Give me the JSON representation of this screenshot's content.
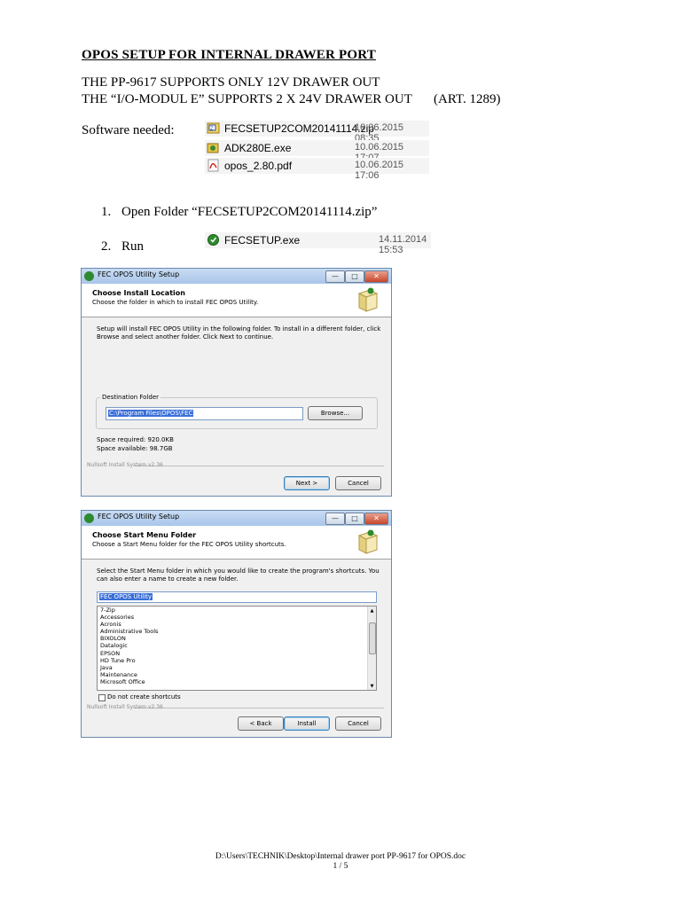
{
  "doc": {
    "title": "OPOS SETUP FOR INTERNAL DRAWER PORT",
    "line1": "THE PP-9617 SUPPORTS ONLY 12V DRAWER OUT",
    "line2": "THE “I/O-MODUL E” SUPPORTS 2 X 24V DRAWER OUT",
    "line2_art": "(ART. 1289)",
    "software_label": "Software needed:",
    "files": [
      {
        "name": "FECSETUP2COM20141114.zip",
        "date": "10.06.2015 08:35",
        "icon": "zip-icon"
      },
      {
        "name": "ADK280E.exe",
        "date": "10.06.2015 17:07",
        "icon": "exe-icon"
      },
      {
        "name": "opos_2.80.pdf",
        "date": "10.06.2015 17:06",
        "icon": "pdf-icon"
      }
    ],
    "step1_num": "1.",
    "step1_text": "Open Folder “FECSETUP2COM20141114.zip”",
    "step2_num": "2.",
    "step2_text": "Run",
    "run_file": {
      "name": "FECSETUP.exe",
      "date": "14.11.2014 15:53",
      "icon": "setup-icon"
    }
  },
  "dialog1": {
    "title": "FEC OPOS Utility Setup",
    "heading": "Choose Install Location",
    "subheading": "Choose the folder in which to install FEC OPOS Utility.",
    "body1": "Setup will install FEC OPOS Utility in the following folder. To install in a different folder, click",
    "body2": "Browse and select another folder. Click Next to continue.",
    "dest_label": "Destination Folder",
    "dest_value": "C:\\Program Files\\OPOS\\FEC",
    "browse": "Browse...",
    "space_required": "Space required: 920.0KB",
    "space_available": "Space available: 98.7GB",
    "nsis": "Nullsoft Install System v2.36",
    "next": "Next >",
    "cancel": "Cancel"
  },
  "dialog2": {
    "title": "FEC OPOS Utility Setup",
    "heading": "Choose Start Menu Folder",
    "subheading": "Choose a Start Menu folder for the FEC OPOS Utility shortcuts.",
    "body1": "Select the Start Menu folder in which you would like to create the program's shortcuts. You",
    "body2": "can also enter a name to create a new folder.",
    "folder_value": "FEC OPOS Utility",
    "list_items": [
      "7-Zip",
      "Accessories",
      "Acronis",
      "Administrative Tools",
      "BIXOLON",
      "Datalogic",
      "EPSON",
      "HD Tune Pro",
      "Java",
      "Maintenance",
      "Microsoft Office"
    ],
    "checkbox_label": "Do not create shortcuts",
    "nsis": "Nullsoft Install System v2.36",
    "back": "< Back",
    "install": "Install",
    "cancel": "Cancel"
  },
  "footer": {
    "path": "D:\\Users\\TECHNIK\\Desktop\\Internal drawer port PP-9617 for OPOS.doc",
    "page": "1 / 5"
  }
}
